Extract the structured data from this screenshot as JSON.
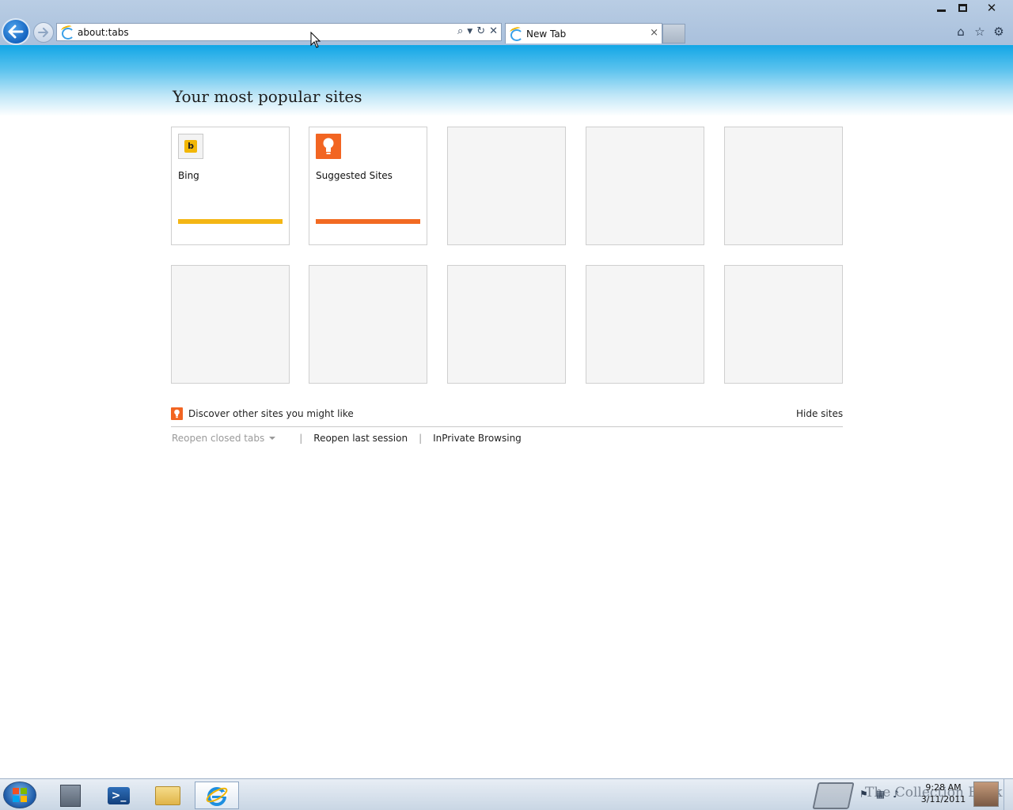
{
  "browser": {
    "address_value": "about:tabs",
    "tab_title": "New Tab",
    "tab_close": "×",
    "window": {
      "minimize": "",
      "maximize": "",
      "close": "✕"
    }
  },
  "page": {
    "title": "Your most popular sites",
    "tiles_row1": [
      {
        "name": "Bing",
        "bar_color": "#f4b614",
        "icon": "bing-icon"
      },
      {
        "name": "Suggested Sites",
        "bar_color": "#f26a22",
        "icon": "suggested-sites-icon"
      },
      {
        "name": ""
      },
      {
        "name": ""
      },
      {
        "name": ""
      }
    ],
    "tiles_row2": [
      {
        "name": ""
      },
      {
        "name": ""
      },
      {
        "name": ""
      },
      {
        "name": ""
      },
      {
        "name": ""
      }
    ],
    "discover_label": "Discover other sites you might like",
    "hide_sites_label": "Hide sites",
    "reopen_closed_tabs_label": "Reopen closed tabs",
    "reopen_last_session_label": "Reopen last session",
    "inprivate_label": "InPrivate Browsing",
    "separator": "|"
  },
  "taskbar": {
    "items": [
      "server-manager-icon",
      "powershell-icon",
      "explorer-folder-icon",
      "internet-explorer-icon"
    ],
    "watermark_text": "The Collection Book",
    "clock_time": "9:28 AM",
    "clock_date": "3/11/2011"
  },
  "colors": {
    "accent_blue": "#12a6e6",
    "bing_yellow": "#f4b614",
    "suggested_orange": "#f26a22"
  }
}
